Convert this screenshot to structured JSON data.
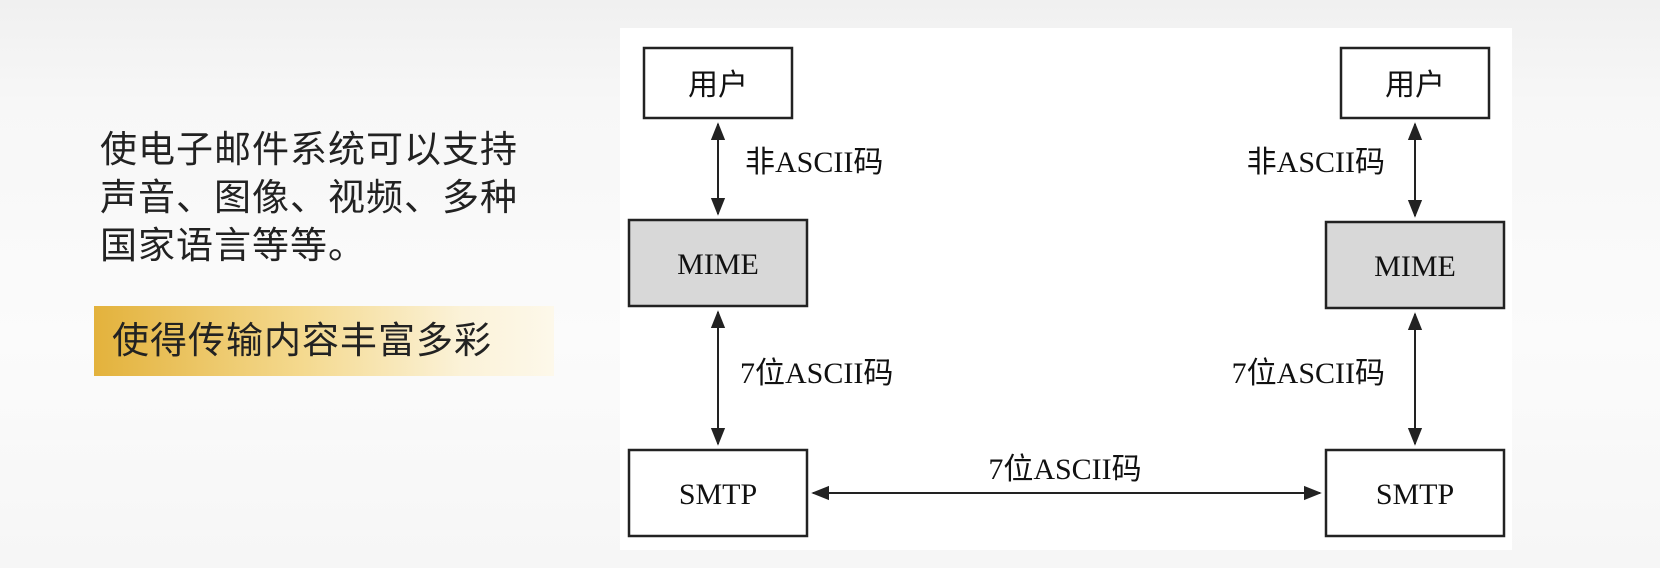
{
  "description": "使电子邮件系统可以支持声音、图像、视频、多种国家语言等等。",
  "highlight": "使得传输内容丰富多彩",
  "diagram": {
    "left": {
      "user": "用户",
      "mime": "MIME",
      "smtp": "SMTP",
      "user_mime_label": "非ASCII码",
      "mime_smtp_label": "7位ASCII码"
    },
    "right": {
      "user": "用户",
      "mime": "MIME",
      "smtp": "SMTP",
      "user_mime_label": "非ASCII码",
      "mime_smtp_label": "7位ASCII码"
    },
    "smtp_link_label": "7位ASCII码",
    "colors": {
      "mime_fill": "#d8d8d8",
      "highlight_gold": "#e3b23c"
    }
  }
}
